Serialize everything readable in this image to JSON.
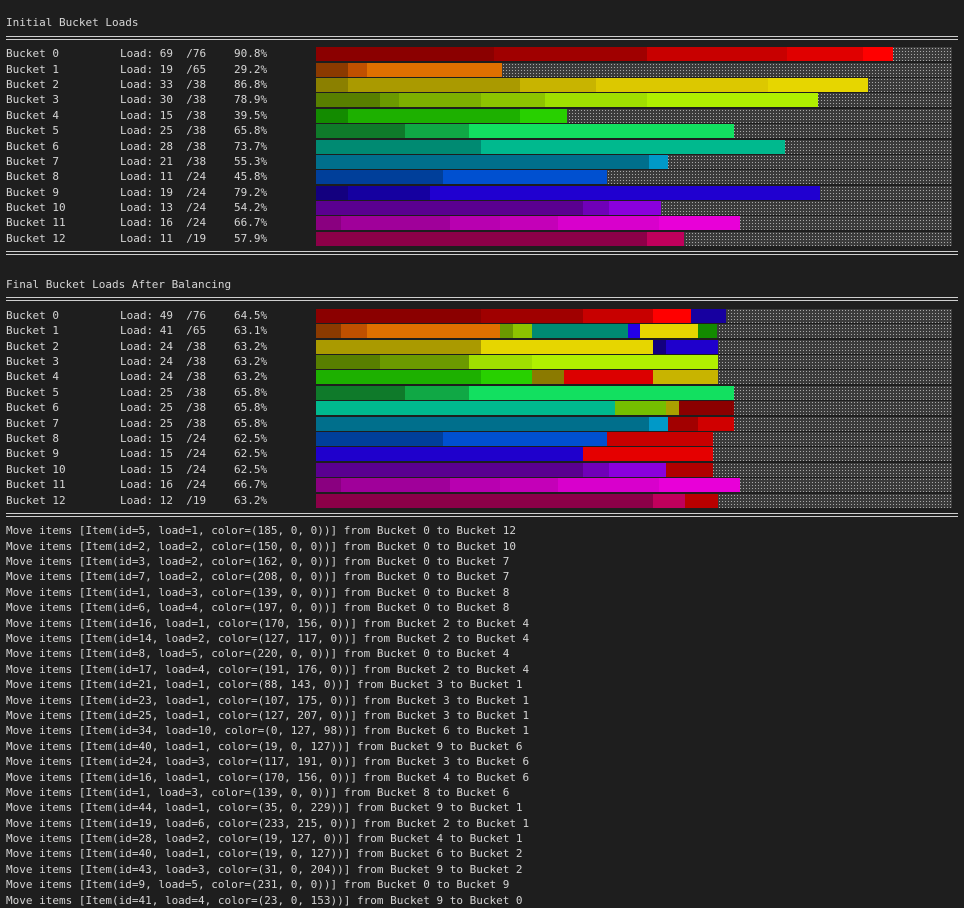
{
  "sections": [
    {
      "title": "Initial Bucket Loads",
      "buckets": [
        {
          "name": "Bucket 0",
          "load": "Load: 69  /76",
          "pct": "90.8%",
          "segs": [
            [
              0,
              28,
              "#8b0000"
            ],
            [
              28,
              52,
              "#a00000"
            ],
            [
              52,
              74,
              "#c80000"
            ],
            [
              74,
              86,
              "#e00000"
            ],
            [
              86,
              90.8,
              "#ff0000"
            ]
          ]
        },
        {
          "name": "Bucket 1",
          "load": "Load: 19  /65",
          "pct": "29.2%",
          "segs": [
            [
              0,
              5,
              "#8b3a00"
            ],
            [
              5,
              8,
              "#c05000"
            ],
            [
              8,
              29.2,
              "#e07000"
            ]
          ]
        },
        {
          "name": "Bucket 2",
          "load": "Load: 33  /38",
          "pct": "86.8%",
          "segs": [
            [
              0,
              5,
              "#8b8000"
            ],
            [
              5,
              32,
              "#aa9a00"
            ],
            [
              32,
              44,
              "#c8b400"
            ],
            [
              44,
              71,
              "#dcc800"
            ],
            [
              71,
              86.8,
              "#e6d600"
            ]
          ]
        },
        {
          "name": "Bucket 3",
          "load": "Load: 30  /38",
          "pct": "78.9%",
          "segs": [
            [
              0,
              10,
              "#587f00"
            ],
            [
              10,
              13,
              "#6b9a00"
            ],
            [
              13,
              26,
              "#7daf00"
            ],
            [
              26,
              36,
              "#8dc400"
            ],
            [
              36,
              52,
              "#a0df00"
            ],
            [
              52,
              78.9,
              "#b0f000"
            ]
          ]
        },
        {
          "name": "Bucket 4",
          "load": "Load: 15  /38",
          "pct": "39.5%",
          "segs": [
            [
              0,
              5,
              "#138b00"
            ],
            [
              5,
              32,
              "#1db000"
            ],
            [
              32,
              39.5,
              "#28d000"
            ]
          ]
        },
        {
          "name": "Bucket 5",
          "load": "Load: 25  /38",
          "pct": "65.8%",
          "segs": [
            [
              0,
              14,
              "#0f7a2a"
            ],
            [
              14,
              24,
              "#10a845"
            ],
            [
              24,
              65.8,
              "#12e060"
            ]
          ]
        },
        {
          "name": "Bucket 6",
          "load": "Load: 28  /38",
          "pct": "73.7%",
          "segs": [
            [
              0,
              26,
              "#008a72"
            ],
            [
              26,
              73.7,
              "#00b98e"
            ]
          ]
        },
        {
          "name": "Bucket 7",
          "load": "Load: 21  /38",
          "pct": "55.3%",
          "segs": [
            [
              0,
              52.4,
              "#006f8c"
            ],
            [
              52.4,
              55.3,
              "#0099c8"
            ]
          ]
        },
        {
          "name": "Bucket 8",
          "load": "Load: 11  /24",
          "pct": "45.8%",
          "segs": [
            [
              0,
              20,
              "#003f9a"
            ],
            [
              20,
              45.8,
              "#0050d0"
            ]
          ]
        },
        {
          "name": "Bucket 9",
          "load": "Load: 19  /24",
          "pct": "79.2%",
          "segs": [
            [
              0,
              5,
              "#13007f"
            ],
            [
              5,
              18,
              "#1500a0"
            ],
            [
              18,
              79.2,
              "#2000d0"
            ]
          ]
        },
        {
          "name": "Bucket 10",
          "load": "Load: 13  /24",
          "pct": "54.2%",
          "segs": [
            [
              0,
              42,
              "#5a0090"
            ],
            [
              42,
              46,
              "#7000b8"
            ],
            [
              46,
              54.2,
              "#8a00dc"
            ]
          ]
        },
        {
          "name": "Bucket 11",
          "load": "Load: 16  /24",
          "pct": "66.7%",
          "segs": [
            [
              0,
              4,
              "#8a0080"
            ],
            [
              4,
              21,
              "#a0009a"
            ],
            [
              21,
              29,
              "#b800b0"
            ],
            [
              29,
              38,
              "#c400b8"
            ],
            [
              38,
              54,
              "#d800cc"
            ],
            [
              54,
              66.7,
              "#e800d8"
            ]
          ]
        },
        {
          "name": "Bucket 12",
          "load": "Load: 11  /19",
          "pct": "57.9%",
          "segs": [
            [
              0,
              52,
              "#8c0048"
            ],
            [
              52,
              57.9,
              "#c0005c"
            ]
          ]
        }
      ]
    },
    {
      "title": "Final Bucket Loads After Balancing",
      "buckets": [
        {
          "name": "Bucket 0",
          "load": "Load: 49  /76",
          "pct": "64.5%",
          "segs": [
            [
              0,
              26,
              "#8b0000"
            ],
            [
              26,
              42,
              "#a00000"
            ],
            [
              42,
              53,
              "#c80000"
            ],
            [
              53,
              59,
              "#ff0000"
            ],
            [
              59,
              64.5,
              "#1700a0"
            ]
          ]
        },
        {
          "name": "Bucket 1",
          "load": "Load: 41  /65",
          "pct": "63.1%",
          "segs": [
            [
              0,
              4,
              "#8b3a00"
            ],
            [
              4,
              8,
              "#c05000"
            ],
            [
              8,
              29,
              "#e07000"
            ],
            [
              29,
              31,
              "#6b9a00"
            ],
            [
              31,
              34,
              "#8dc400"
            ],
            [
              34,
              49,
              "#008a72"
            ],
            [
              49,
              51,
              "#2300e5"
            ],
            [
              51,
              60,
              "#e6d600"
            ],
            [
              60,
              63.1,
              "#138b00"
            ]
          ]
        },
        {
          "name": "Bucket 2",
          "load": "Load: 24  /38",
          "pct": "63.2%",
          "segs": [
            [
              0,
              26,
              "#aa9a00"
            ],
            [
              26,
              53,
              "#e6d600"
            ],
            [
              53,
              55,
              "#13007f"
            ],
            [
              55,
              63.2,
              "#1f00cc"
            ]
          ]
        },
        {
          "name": "Bucket 3",
          "load": "Load: 24  /38",
          "pct": "63.2%",
          "segs": [
            [
              0,
              10,
              "#587f00"
            ],
            [
              10,
              24,
              "#6b9a00"
            ],
            [
              24,
              34,
              "#a0df00"
            ],
            [
              34,
              63.2,
              "#b0f000"
            ]
          ]
        },
        {
          "name": "Bucket 4",
          "load": "Load: 24  /38",
          "pct": "63.2%",
          "segs": [
            [
              0,
              26,
              "#1db000"
            ],
            [
              26,
              34,
              "#28d000"
            ],
            [
              34,
              39,
              "#8b7a00"
            ],
            [
              39,
              53,
              "#dc0000"
            ],
            [
              53,
              63.2,
              "#c8b400"
            ]
          ]
        },
        {
          "name": "Bucket 5",
          "load": "Load: 25  /38",
          "pct": "65.8%",
          "segs": [
            [
              0,
              14,
              "#0f7a2a"
            ],
            [
              14,
              24,
              "#10a845"
            ],
            [
              24,
              65.8,
              "#12e060"
            ]
          ]
        },
        {
          "name": "Bucket 6",
          "load": "Load: 25  /38",
          "pct": "65.8%",
          "segs": [
            [
              0,
              47,
              "#00b98e"
            ],
            [
              47,
              55,
              "#75bf00"
            ],
            [
              55,
              57,
              "#aaa000"
            ],
            [
              57,
              65.8,
              "#8b0000"
            ]
          ]
        },
        {
          "name": "Bucket 7",
          "load": "Load: 25  /38",
          "pct": "65.8%",
          "segs": [
            [
              0,
              52.4,
              "#006f8c"
            ],
            [
              52.4,
              55.3,
              "#0099c8"
            ],
            [
              55.3,
              60,
              "#a20000"
            ],
            [
              60,
              65.8,
              "#d00000"
            ]
          ]
        },
        {
          "name": "Bucket 8",
          "load": "Load: 15  /24",
          "pct": "62.5%",
          "segs": [
            [
              0,
              20,
              "#003f9a"
            ],
            [
              20,
              45.8,
              "#0050d0"
            ],
            [
              45.8,
              62.5,
              "#c80000"
            ]
          ]
        },
        {
          "name": "Bucket 9",
          "load": "Load: 15  /24",
          "pct": "62.5%",
          "segs": [
            [
              0,
              42,
              "#1f00cc"
            ],
            [
              42,
              62.5,
              "#e50000"
            ]
          ]
        },
        {
          "name": "Bucket 10",
          "load": "Load: 15  /24",
          "pct": "62.5%",
          "segs": [
            [
              0,
              42,
              "#5a0090"
            ],
            [
              42,
              46,
              "#7000b8"
            ],
            [
              46,
              55,
              "#8a00dc"
            ],
            [
              55,
              62.5,
              "#b00000"
            ]
          ]
        },
        {
          "name": "Bucket 11",
          "load": "Load: 16  /24",
          "pct": "66.7%",
          "segs": [
            [
              0,
              4,
              "#8a0080"
            ],
            [
              4,
              21,
              "#a0009a"
            ],
            [
              21,
              29,
              "#b800b0"
            ],
            [
              29,
              38,
              "#c400b8"
            ],
            [
              38,
              54,
              "#d800cc"
            ],
            [
              54,
              66.7,
              "#e800d8"
            ]
          ]
        },
        {
          "name": "Bucket 12",
          "load": "Load: 12  /19",
          "pct": "63.2%",
          "segs": [
            [
              0,
              53,
              "#8c0048"
            ],
            [
              53,
              58,
              "#c0005c"
            ],
            [
              58,
              63.2,
              "#b90000"
            ]
          ]
        }
      ]
    }
  ],
  "log": [
    "Move items [Item(id=5, load=1, color=(185, 0, 0))] from Bucket 0 to Bucket 12",
    "Move items [Item(id=2, load=2, color=(150, 0, 0))] from Bucket 0 to Bucket 10",
    "Move items [Item(id=3, load=2, color=(162, 0, 0))] from Bucket 0 to Bucket 7",
    "Move items [Item(id=7, load=2, color=(208, 0, 0))] from Bucket 0 to Bucket 7",
    "Move items [Item(id=1, load=3, color=(139, 0, 0))] from Bucket 0 to Bucket 8",
    "Move items [Item(id=6, load=4, color=(197, 0, 0))] from Bucket 0 to Bucket 8",
    "Move items [Item(id=16, load=1, color=(170, 156, 0))] from Bucket 2 to Bucket 4",
    "Move items [Item(id=14, load=2, color=(127, 117, 0))] from Bucket 2 to Bucket 4",
    "Move items [Item(id=8, load=5, color=(220, 0, 0))] from Bucket 0 to Bucket 4",
    "Move items [Item(id=17, load=4, color=(191, 176, 0))] from Bucket 2 to Bucket 4",
    "Move items [Item(id=21, load=1, color=(88, 143, 0))] from Bucket 3 to Bucket 1",
    "Move items [Item(id=23, load=1, color=(107, 175, 0))] from Bucket 3 to Bucket 1",
    "Move items [Item(id=25, load=1, color=(127, 207, 0))] from Bucket 3 to Bucket 1",
    "Move items [Item(id=34, load=10, color=(0, 127, 98))] from Bucket 6 to Bucket 1",
    "Move items [Item(id=40, load=1, color=(19, 0, 127))] from Bucket 9 to Bucket 6",
    "Move items [Item(id=24, load=3, color=(117, 191, 0))] from Bucket 3 to Bucket 6",
    "Move items [Item(id=16, load=1, color=(170, 156, 0))] from Bucket 4 to Bucket 6",
    "Move items [Item(id=1, load=3, color=(139, 0, 0))] from Bucket 8 to Bucket 6",
    "Move items [Item(id=44, load=1, color=(35, 0, 229))] from Bucket 9 to Bucket 1",
    "Move items [Item(id=19, load=6, color=(233, 215, 0))] from Bucket 2 to Bucket 1",
    "Move items [Item(id=28, load=2, color=(19, 127, 0))] from Bucket 4 to Bucket 1",
    "Move items [Item(id=40, load=1, color=(19, 0, 127))] from Bucket 6 to Bucket 2",
    "Move items [Item(id=43, load=3, color=(31, 0, 204))] from Bucket 9 to Bucket 2",
    "Move items [Item(id=9, load=5, color=(231, 0, 0))] from Bucket 0 to Bucket 9",
    "Move items [Item(id=41, load=4, color=(23, 0, 153))] from Bucket 9 to Bucket 0"
  ]
}
